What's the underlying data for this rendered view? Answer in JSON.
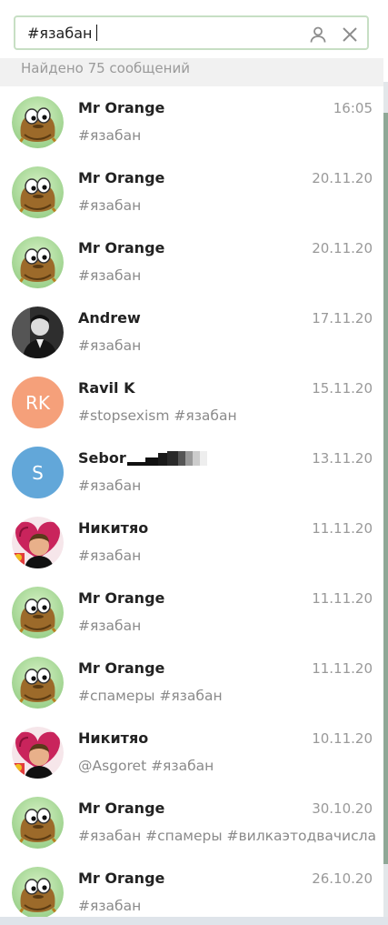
{
  "search": {
    "value": "#язабан"
  },
  "results_label": "Найдено 75 сообщений",
  "results": [
    {
      "name": "Mr Orange",
      "date": "16:05",
      "text": "#язабан",
      "avatar": "frog"
    },
    {
      "name": "Mr Orange",
      "date": "20.11.20",
      "text": "#язабан",
      "avatar": "frog"
    },
    {
      "name": "Mr Orange",
      "date": "20.11.20",
      "text": "#язабан",
      "avatar": "frog"
    },
    {
      "name": "Andrew",
      "date": "17.11.20",
      "text": "#язабан",
      "avatar": "photo-man"
    },
    {
      "name": "Ravil K",
      "date": "15.11.20",
      "text": "#stopsexism #язабан",
      "avatar": "initials",
      "initials": "RK",
      "color": "#f5a07a"
    },
    {
      "name": "Sebor",
      "date": "13.11.20",
      "text": "#язабан",
      "avatar": "initials",
      "initials": "S",
      "color": "#62a7d9"
    },
    {
      "name": "Никитяо",
      "date": "11.11.20",
      "text": "#язабан",
      "avatar": "photo-heart"
    },
    {
      "name": "Mr Orange",
      "date": "11.11.20",
      "text": "#язабан",
      "avatar": "frog"
    },
    {
      "name": "Mr Orange",
      "date": "11.11.20",
      "text": "#спамеры #язабан",
      "avatar": "frog"
    },
    {
      "name": "Никитяо",
      "date": "10.11.20",
      "text": "@Asgoret #язабан",
      "avatar": "photo-heart"
    },
    {
      "name": "Mr Orange",
      "date": "30.10.20",
      "text": "#язабан #спамеры #вилкаэтодвачисла",
      "avatar": "frog"
    },
    {
      "name": "Mr Orange",
      "date": "26.10.20",
      "text": "#язабан",
      "avatar": "frog"
    }
  ]
}
